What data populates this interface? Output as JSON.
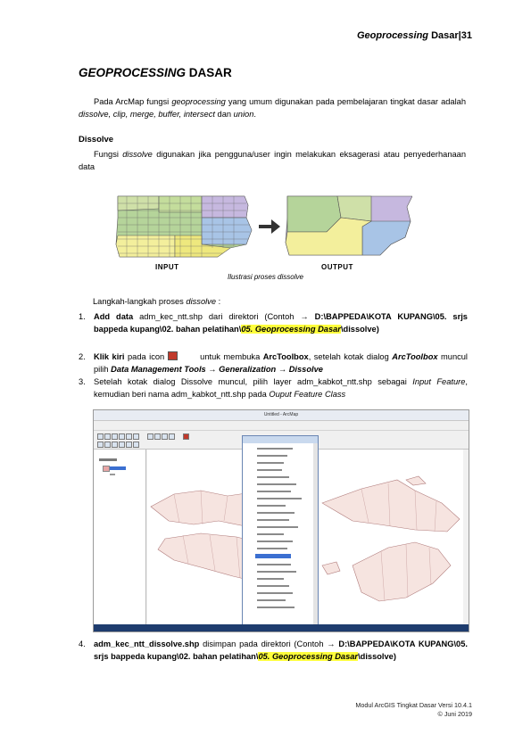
{
  "header": {
    "italic": "Geoprocessing",
    "rest": " Dasar|",
    "page": "31"
  },
  "title": {
    "italic": "GEOPROCESSING",
    "rest": " DASAR"
  },
  "intro_para": {
    "t1": "Pada ArcMap fungsi ",
    "t2": "geoprocessing",
    "t3": " yang umum digunakan pada pembelajaran tingkat dasar adalah ",
    "t4": "dissolve, clip, merge, buffer, intersect",
    "t5": " dan ",
    "t6": "union",
    "t7": "."
  },
  "dissolve_heading": "Dissolve",
  "dissolve_para": {
    "t1": "Fungsi ",
    "t2": "dissolve",
    "t3": " digunakan jika pengguna/user ingin melakukan eksagerasi atau penyederhanaan data"
  },
  "figure": {
    "input_label": "INPUT",
    "output_label": "OUTPUT",
    "caption": "Ilustrasi proses dissolve",
    "arrow_color": "#333333"
  },
  "steps_intro": {
    "t1": "Langkah-langkah proses ",
    "t2": "dissolve",
    "t3": " :"
  },
  "steps": [
    {
      "num": "1.",
      "a": "Add data",
      "b": " adm_kec_ntt.shp dari direktori (Contoh → ",
      "c": "D:\\BAPPEDA\\KOTA KUPANG\\05. srjs bappeda kupang\\02. bahan pelatihan\\",
      "d": "05. Geoprocessing Dasar",
      "e": "\\dissolve)"
    },
    {
      "num": "2.",
      "a": "Klik kiri",
      "b": " pada icon ",
      "c": " untuk membuka ",
      "d": "ArcToolbox",
      "e": ", setelah kotak dialog ",
      "f": "ArcToolbox",
      "g": " muncul pilih ",
      "h": "Data Management Tools → Generalization → Dissolve"
    },
    {
      "num": "3.",
      "a": "Setelah kotak dialog Dissolve muncul, pilih layer adm_kabkot_ntt.shp sebagai ",
      "b": "Input Feature",
      "c": ", kemudian beri nama adm_kabkot_ntt.shp pada ",
      "d": "Ouput Feature Class"
    },
    {
      "num": "4.",
      "a": "adm_kec_ntt_dissolve.shp",
      "b": " disimpan pada direktori (Contoh → ",
      "c": "D:\\BAPPEDA\\KOTA KUPANG\\05. srjs bappeda kupang\\02. bahan pelatihan\\",
      "d": "05. Geoprocessing Dasar",
      "e": "\\dissolve)"
    }
  ],
  "screenshot": {
    "window_title": "Untitled - ArcMap"
  },
  "colors": {
    "highlight": "#ffff3c",
    "map_fill": "#f6e4e0",
    "map_stroke": "#b07b7b"
  },
  "footer": {
    "line1": "Modul ArcGIS Tingkat Dasar Versi 10.4.1",
    "line2": "© Juni 2019"
  }
}
